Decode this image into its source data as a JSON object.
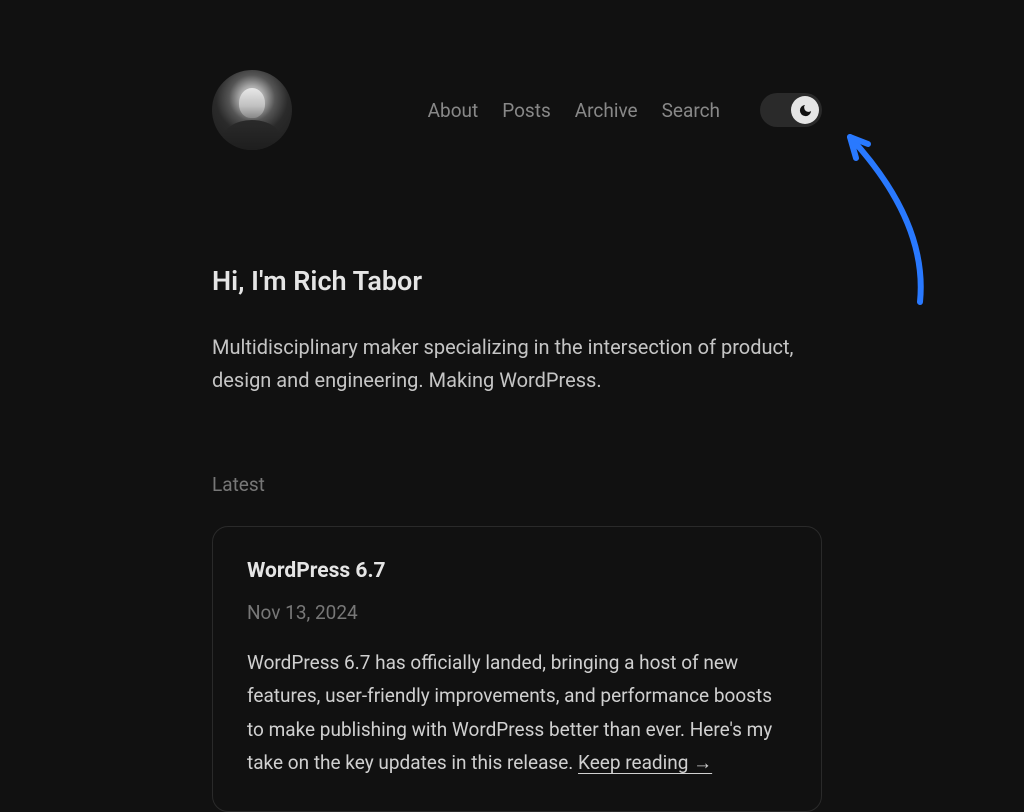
{
  "nav": {
    "links": [
      "About",
      "Posts",
      "Archive",
      "Search"
    ]
  },
  "hero": {
    "greeting": "Hi, I'm Rich Tabor",
    "bio": "Multidisciplinary maker specializing in the intersection of product, design and engineering. Making WordPress."
  },
  "latest": {
    "label": "Latest",
    "post": {
      "title": "WordPress 6.7",
      "date": "Nov 13, 2024",
      "excerpt": "WordPress 6.7 has officially landed, bringing a host of new features, user-friendly improvements, and performance boosts to make publishing with WordPress better than ever. Here's my take on the key updates in this release. ",
      "keep_reading": "Keep reading →"
    }
  },
  "colors": {
    "accent_arrow": "#2979ff"
  }
}
